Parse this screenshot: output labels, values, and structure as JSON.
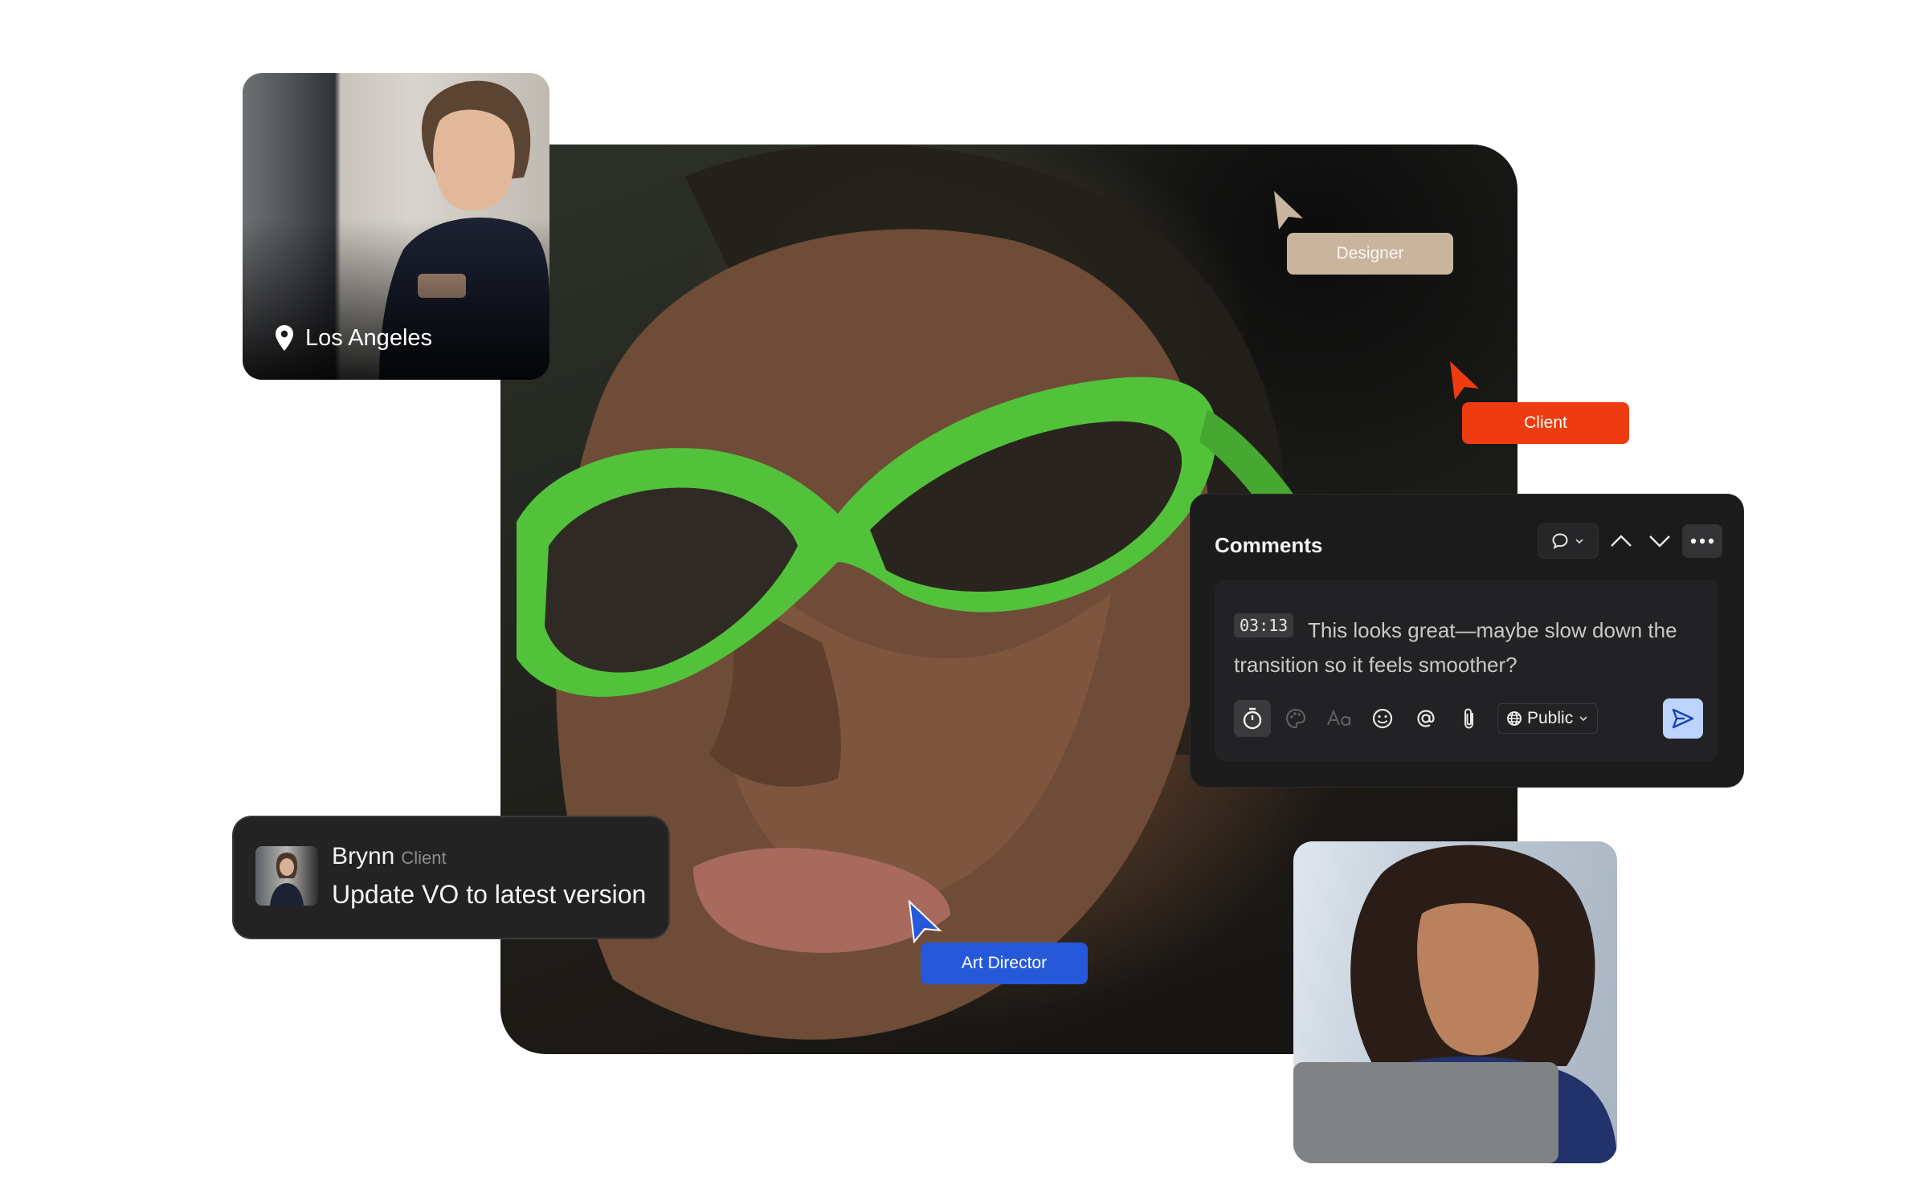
{
  "thumbnail_location": {
    "label": "Los Angeles",
    "icon": "location-pin-icon"
  },
  "cursors": {
    "designer": {
      "label": "Designer",
      "color": "#c9b49e"
    },
    "client": {
      "label": "Client",
      "color": "#ee3c10"
    },
    "art_director": {
      "label": "Art Director",
      "color": "#2659d9"
    }
  },
  "comments": {
    "title": "Comments",
    "timestamp": "03:13",
    "text": "This looks great—maybe slow down the transition so it feels smoother?",
    "visibility": "Public",
    "icons": [
      "comment-bubble-icon",
      "chevron-down-icon",
      "chevron-up-icon",
      "more-icon",
      "timer-icon",
      "palette-icon",
      "text-format-icon",
      "emoji-icon",
      "mention-icon",
      "attachment-icon",
      "globe-icon",
      "send-icon"
    ]
  },
  "notification": {
    "name": "Brynn",
    "role": "Client",
    "message": "Update VO to latest version"
  }
}
